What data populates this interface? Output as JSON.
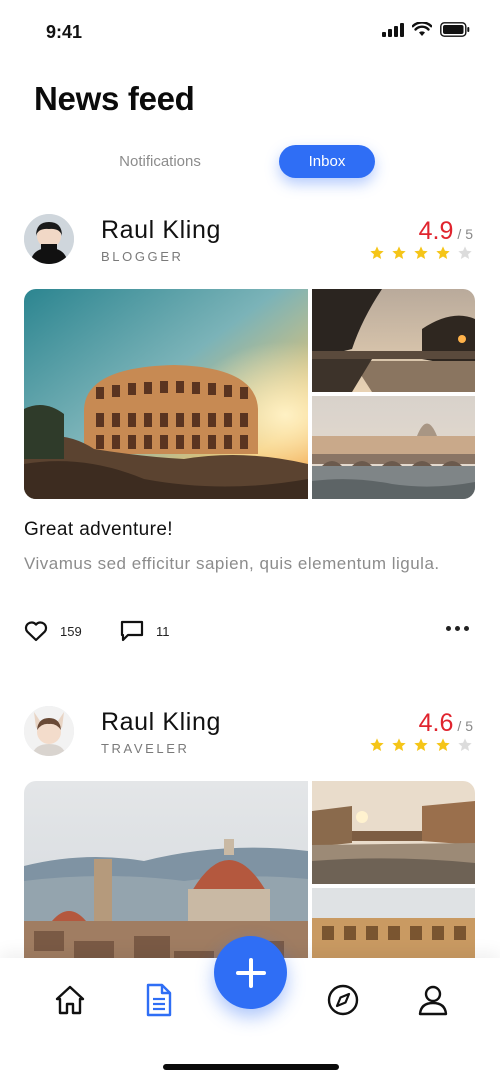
{
  "status_bar": {
    "time": "9:41"
  },
  "header": {
    "title": "News feed"
  },
  "tabs": [
    {
      "label": "Notifications",
      "active": false
    },
    {
      "label": "Inbox",
      "active": true
    }
  ],
  "posts": [
    {
      "author": {
        "name": "Raul Kling",
        "role": "BLOGGER"
      },
      "rating": {
        "value": "4.9",
        "max": "/ 5",
        "stars": 4
      },
      "title": "Great adventure!",
      "body": "Vivamus sed efficitur sapien, quis elementum ligula.",
      "likes": "159",
      "comments": "11"
    },
    {
      "author": {
        "name": "Raul Kling",
        "role": "TRAVELER"
      },
      "rating": {
        "value": "4.6",
        "max": "/ 5",
        "stars": 4
      }
    }
  ],
  "bottom_nav": {
    "items": [
      "home-icon",
      "document-icon",
      "plus-icon",
      "compass-icon",
      "user-icon"
    ]
  },
  "colors": {
    "accent": "#2f6ef5",
    "rating": "#e0242e",
    "star": "#f5c518",
    "star_empty": "#d9d9d9"
  }
}
